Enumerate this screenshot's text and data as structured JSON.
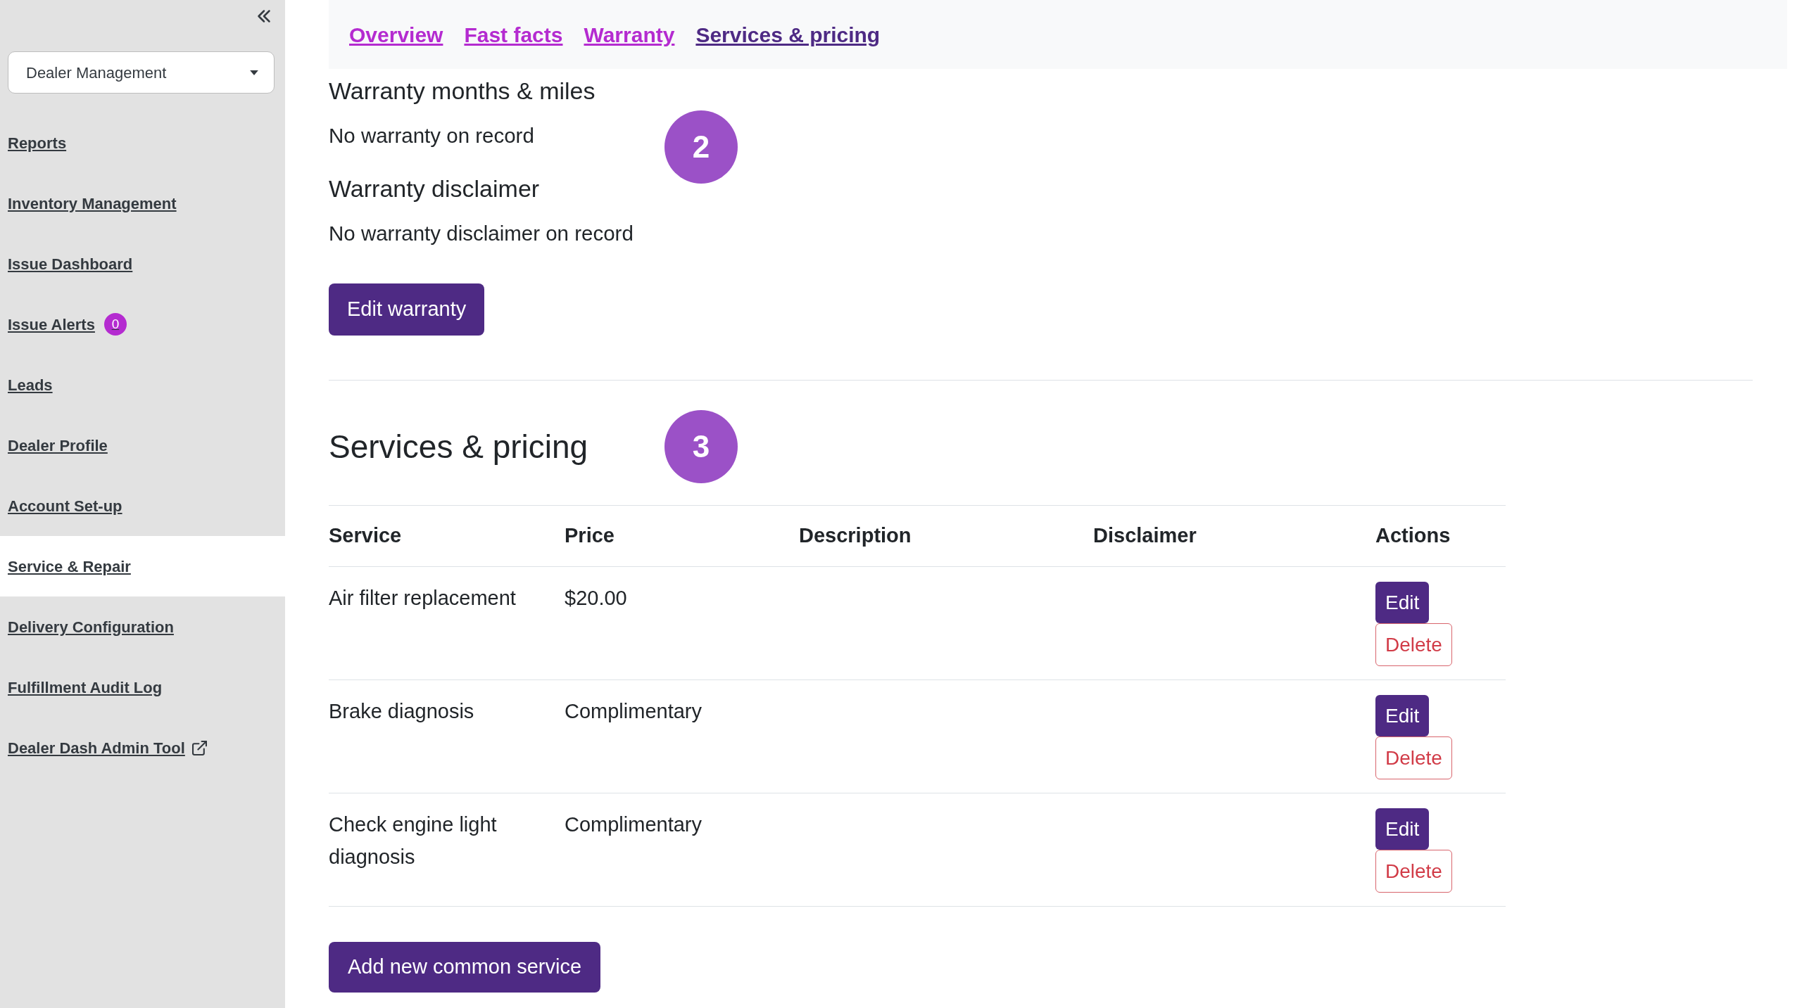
{
  "sidebar": {
    "dropdown": {
      "value": "Dealer Management"
    },
    "items": [
      {
        "label": "Reports",
        "selected": false,
        "external": false
      },
      {
        "label": "Inventory Management",
        "selected": false,
        "external": false
      },
      {
        "label": "Issue Dashboard",
        "selected": false,
        "external": false
      },
      {
        "label": "Issue Alerts",
        "selected": false,
        "external": false,
        "badge": "0"
      },
      {
        "label": "Leads",
        "selected": false,
        "external": false
      },
      {
        "label": "Dealer Profile",
        "selected": false,
        "external": false
      },
      {
        "label": "Account Set-up",
        "selected": false,
        "external": false
      },
      {
        "label": "Service & Repair",
        "selected": true,
        "external": false
      },
      {
        "label": "Delivery Configuration",
        "selected": false,
        "external": false
      },
      {
        "label": "Fulfillment Audit Log",
        "selected": false,
        "external": false
      },
      {
        "label": "Dealer Dash Admin Tool",
        "selected": false,
        "external": true
      }
    ]
  },
  "tabs": [
    {
      "label": "Overview",
      "selected": false
    },
    {
      "label": "Fast facts",
      "selected": false
    },
    {
      "label": "Warranty",
      "selected": false
    },
    {
      "label": "Services & pricing",
      "selected": true
    }
  ],
  "warranty": {
    "fields": [
      {
        "heading": "Warranty months & miles",
        "value": "No warranty on record"
      },
      {
        "heading": "Warranty disclaimer",
        "value": "No warranty disclaimer on record"
      }
    ],
    "marker": "2",
    "edit_button": "Edit warranty"
  },
  "services": {
    "heading": "Services & pricing",
    "marker": "3",
    "table": {
      "columns": [
        "Service",
        "Price",
        "Description",
        "Disclaimer",
        "Actions"
      ],
      "rows": [
        {
          "service": "Air filter replacement",
          "price": "$20.00",
          "actions": [
            {
              "label": "Edit",
              "kind": "edit"
            },
            {
              "label": "Delete",
              "kind": "delete"
            }
          ]
        },
        {
          "service": "Brake diagnosis",
          "price": "Complimentary",
          "actions": [
            {
              "label": "Edit",
              "kind": "edit"
            },
            {
              "label": "Delete",
              "kind": "delete"
            }
          ]
        },
        {
          "service": "Check engine light diagnosis",
          "price": "Complimentary",
          "actions": [
            {
              "label": "Edit",
              "kind": "edit"
            },
            {
              "label": "Delete",
              "kind": "delete"
            }
          ]
        }
      ]
    },
    "add_button": "Add new common service"
  }
}
